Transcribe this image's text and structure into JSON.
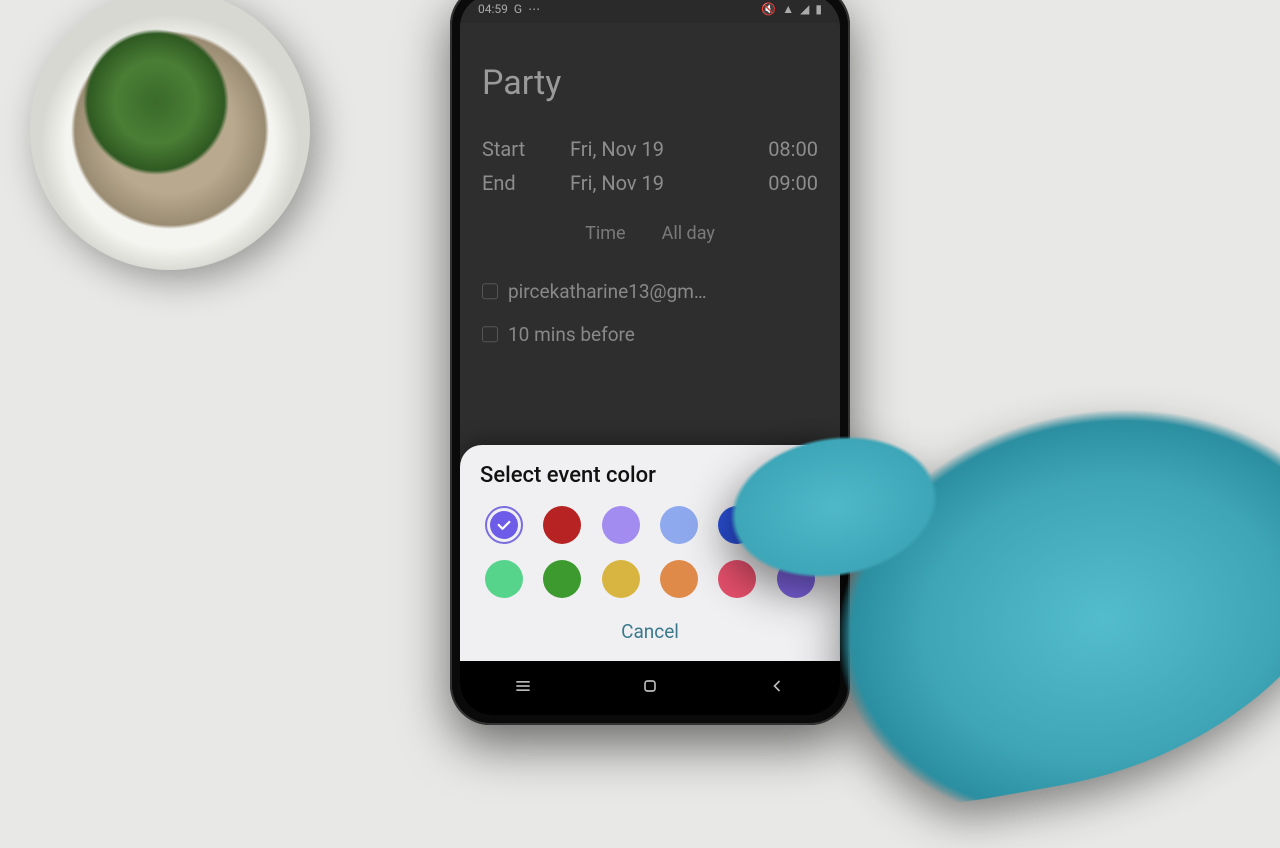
{
  "status": {
    "time": "04:59",
    "google_icon": "G",
    "icons_right": "▮◢▮"
  },
  "event": {
    "title": "Party",
    "start_label": "Start",
    "start_date": "Fri, Nov 19",
    "start_time": "08:00",
    "end_label": "End",
    "end_date": "Fri, Nov 19",
    "end_time": "09:00",
    "tab_time": "Time",
    "tab_allday": "All day",
    "calendar_account": "pircekatharine13@gm…",
    "reminder": "10 mins before"
  },
  "sheet": {
    "title": "Select event color",
    "cancel": "Cancel",
    "colors_row1": [
      "#6c5ce7",
      "#b72222",
      "#a38cf0",
      "#8fa9ef",
      "#2a4fd8",
      "#29c6b8"
    ],
    "colors_row2": [
      "#57d48c",
      "#3c9a2f",
      "#d8b540",
      "#e08a4a",
      "#e54f6b",
      "#7d62e0"
    ],
    "selected_index": 0
  }
}
